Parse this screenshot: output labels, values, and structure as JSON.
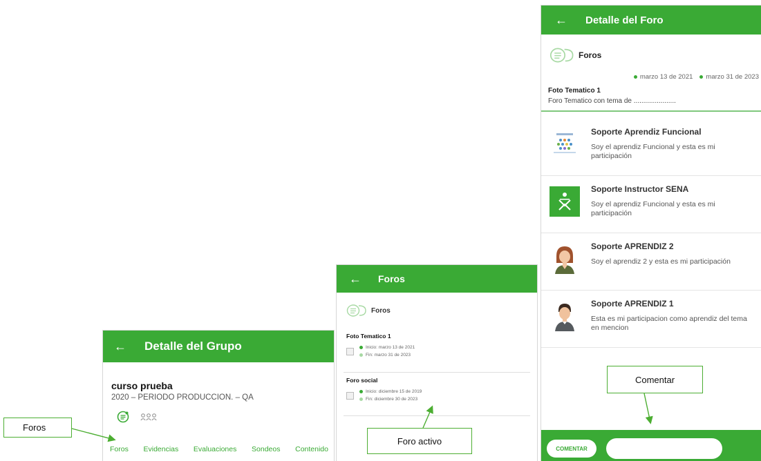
{
  "colors": {
    "primary": "#3aaa35",
    "callout_border": "#4cae32"
  },
  "screen_group": {
    "header_title": "Detalle del Grupo",
    "course_name": "curso prueba",
    "course_period": "2020 – PERIODO PRODUCCION. – QA",
    "icons": [
      "forum-icon",
      "people-icon"
    ],
    "tabs": [
      "Foros",
      "Evidencias",
      "Evaluaciones",
      "Sondeos",
      "Contenido"
    ]
  },
  "screen_forums": {
    "header_title": "Foros",
    "section_label": "Foros",
    "forums": [
      {
        "name": "Foto Tematico 1",
        "start": "Inicio: marzo 13 de 2021",
        "end": "Fin: marzo 31 de 2023"
      },
      {
        "name": "Foro social",
        "start": "Inicio: diciembre 15 de 2019",
        "end": "Fin: diciembre 30 de 2023"
      }
    ]
  },
  "screen_detail": {
    "header_title": "Detalle del Foro",
    "section_label": "Foros",
    "date_start": "marzo 13 de 2021",
    "date_end": "marzo 31 de 2023",
    "topic_title": "Foto Tematico 1",
    "topic_desc": "Foro Tematico con tema de ......................",
    "participants": [
      {
        "name": "Soporte Aprendiz Funcional",
        "text": "Soy el aprendiz Funcional y esta es mi participación",
        "avatar": "infographic-avatar"
      },
      {
        "name": "Soporte Instructor SENA",
        "text": "Soy el aprendiz Funcional y esta es mi participación",
        "avatar": "sena-logo-avatar"
      },
      {
        "name": "Soporte APRENDIZ  2",
        "text": "Soy el aprendiz 2 y esta es mi participación",
        "avatar": "woman-avatar"
      },
      {
        "name": "Soporte APRENDIZ  1",
        "text": "Esta es mi participacion como aprendiz del tema en mencion",
        "avatar": "man-avatar"
      }
    ],
    "comment_button": "COMENTAR",
    "comment_placeholder": ""
  },
  "callouts": {
    "foros": "Foros",
    "foro_activo": "Foro activo",
    "comentar": "Comentar"
  }
}
